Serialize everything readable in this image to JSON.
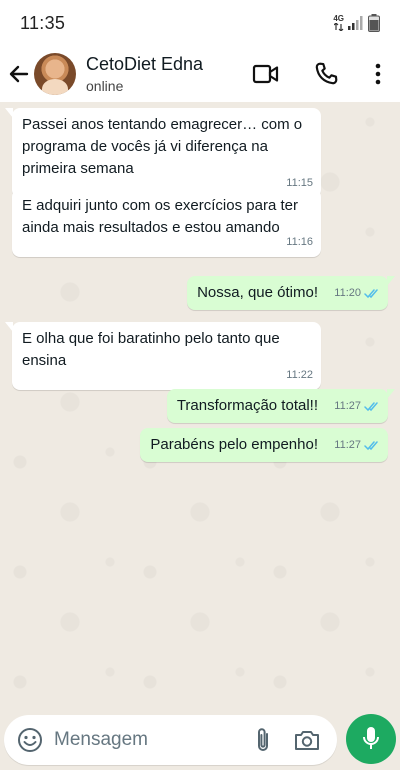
{
  "status_bar": {
    "time": "11:35",
    "network": "4G",
    "icons": [
      "network-arrows-icon",
      "signal-icon",
      "battery-icon"
    ]
  },
  "header": {
    "contact_name": "CetoDiet Edna",
    "contact_status": "online",
    "icons": [
      "back-arrow-icon",
      "avatar",
      "video-call-icon",
      "phone-icon",
      "more-vert-icon"
    ]
  },
  "messages": [
    {
      "direction": "incoming",
      "text": "Passei anos tentando emagrecer… com o programa de vocês já vi diferença na primeira semana",
      "time": "11:15"
    },
    {
      "direction": "incoming",
      "text": "E adquiri junto com os exercícios para ter ainda mais resultados e estou amando",
      "time": "11:16"
    },
    {
      "direction": "outgoing",
      "text": "Nossa, que ótimo!",
      "time": "11:20",
      "read": true
    },
    {
      "direction": "incoming",
      "text": "E olha que foi baratinho pelo tanto que ensina",
      "time": "11:22"
    },
    {
      "direction": "outgoing",
      "text": "Transformação total!!",
      "time": "11:27",
      "read": true
    },
    {
      "direction": "outgoing",
      "text": "Parabéns pelo empenho!",
      "time": "11:27",
      "read": true
    }
  ],
  "composer": {
    "placeholder": "Mensagem",
    "icons": [
      "emoji-icon",
      "attach-icon",
      "camera-icon",
      "mic-icon"
    ]
  },
  "colors": {
    "chat_background": "#efeae2",
    "incoming_bubble": "#ffffff",
    "outgoing_bubble": "#d9fdd3",
    "read_ticks": "#53bdeb",
    "mic_button": "#1daa61"
  }
}
